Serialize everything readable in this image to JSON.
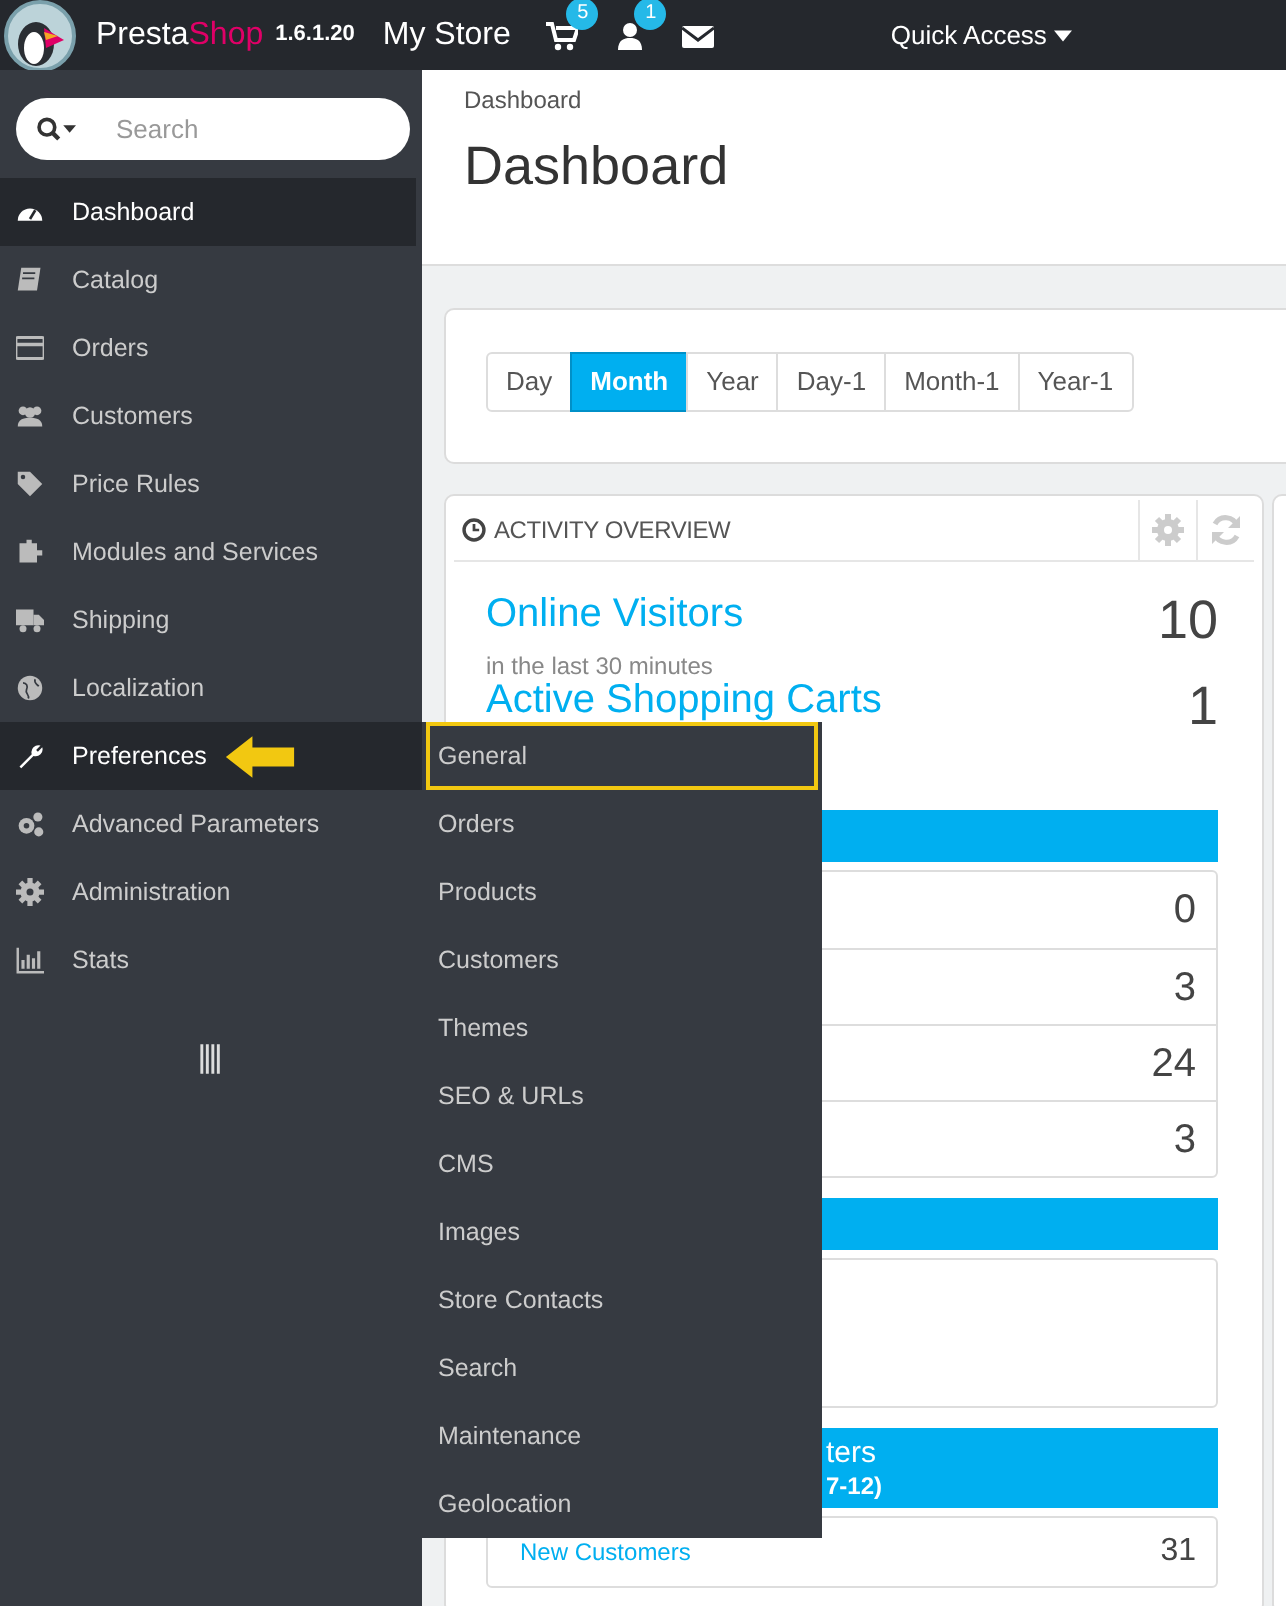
{
  "navbar": {
    "brand_presta": "Presta",
    "brand_shop": "Shop",
    "version": "1.6.1.20",
    "store": "My Store",
    "cart_count": "5",
    "customer_count": "1",
    "quick_access": "Quick Access"
  },
  "sidebar": {
    "search": {
      "placeholder": "Search"
    },
    "items": [
      {
        "label": "Dashboard",
        "active": true
      },
      {
        "label": "Catalog",
        "active": false
      },
      {
        "label": "Orders",
        "active": false
      },
      {
        "label": "Customers",
        "active": false
      },
      {
        "label": "Price Rules",
        "active": false
      },
      {
        "label": "Modules and Services",
        "active": false
      },
      {
        "label": "Shipping",
        "active": false
      },
      {
        "label": "Localization",
        "active": false
      },
      {
        "label": "Preferences",
        "active": true,
        "expanded": true
      },
      {
        "label": "Advanced Parameters",
        "active": false
      },
      {
        "label": "Administration",
        "active": false
      },
      {
        "label": "Stats",
        "active": false
      }
    ],
    "submenu": [
      {
        "label": "General",
        "highlighted": true
      },
      {
        "label": "Orders",
        "highlighted": false
      },
      {
        "label": "Products",
        "highlighted": false
      },
      {
        "label": "Customers",
        "highlighted": false
      },
      {
        "label": "Themes",
        "highlighted": false
      },
      {
        "label": "SEO & URLs",
        "highlighted": false
      },
      {
        "label": "CMS",
        "highlighted": false
      },
      {
        "label": "Images",
        "highlighted": false
      },
      {
        "label": "Store Contacts",
        "highlighted": false
      },
      {
        "label": "Search",
        "highlighted": false
      },
      {
        "label": "Maintenance",
        "highlighted": false
      },
      {
        "label": "Geolocation",
        "highlighted": false
      }
    ]
  },
  "header": {
    "breadcrumb": "Dashboard",
    "title": "Dashboard"
  },
  "date_ranges": [
    {
      "label": "Day",
      "selected": false
    },
    {
      "label": "Month",
      "selected": true
    },
    {
      "label": "Year",
      "selected": false
    },
    {
      "label": "Day-1",
      "selected": false
    },
    {
      "label": "Month-1",
      "selected": false
    },
    {
      "label": "Year-1",
      "selected": false
    }
  ],
  "activity": {
    "title": "ACTIVITY OVERVIEW",
    "metrics": [
      {
        "label": "Online Visitors",
        "sub": "in the last 30 minutes",
        "value": "10"
      },
      {
        "label": "Active Shopping Carts",
        "value": "1"
      }
    ],
    "sections": [
      {
        "kind": "rows",
        "rows": [
          {
            "value": "0"
          },
          {
            "value": "3"
          },
          {
            "value": "24"
          },
          {
            "value": "3"
          }
        ]
      },
      {
        "kind": "box"
      },
      {
        "kind": "rows",
        "heading": [
          "ters",
          "7-12)"
        ],
        "rows": [
          {
            "label": "New Customers",
            "value": "31"
          }
        ]
      }
    ]
  }
}
